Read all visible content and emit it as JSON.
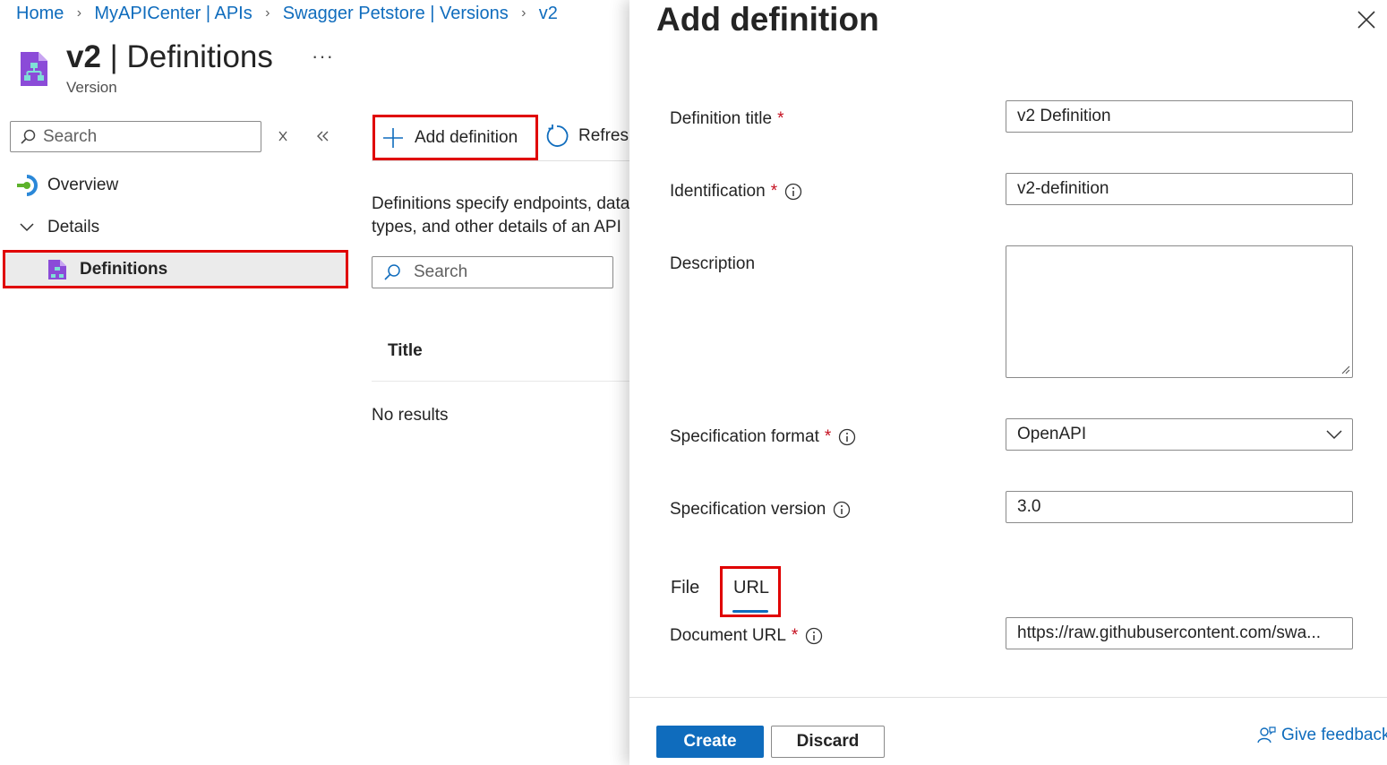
{
  "breadcrumb": [
    "Home",
    "MyAPICenter | APIs",
    "Swagger Petstore | Versions",
    "v2"
  ],
  "page": {
    "title_bold": "v2",
    "title_rest": " | Definitions",
    "subtitle": "Version",
    "more": "···"
  },
  "sidebar": {
    "search_placeholder": "Search",
    "items": [
      {
        "label": "Overview",
        "icon": "overview-icon"
      },
      {
        "label": "Details",
        "icon": "chevron-down-icon"
      },
      {
        "label": "Definitions",
        "icon": "definitions-icon",
        "selected": true
      }
    ]
  },
  "toolbar": {
    "add_label": "Add definition",
    "refresh_label": "Refresh"
  },
  "content": {
    "description": "Definitions specify endpoints, data types, and other details of an API in specification formats, such as OpenAPI, WSDL, GraphQL, and gRPC.",
    "search_placeholder": "Search",
    "column_title": "Title",
    "empty_text": "No results"
  },
  "panel": {
    "title": "Add definition",
    "fields": {
      "definition_title": {
        "label": "Definition title",
        "value": "v2 Definition",
        "required": "*"
      },
      "identification": {
        "label": "Identification",
        "value": "v2-definition",
        "required": "*"
      },
      "description": {
        "label": "Description",
        "value": ""
      },
      "spec_format": {
        "label": "Specification format",
        "value": "OpenAPI",
        "required": "*"
      },
      "spec_version": {
        "label": "Specification version",
        "value": "3.0"
      },
      "document_url": {
        "label": "Document URL",
        "value": "https://raw.githubusercontent.com/swa...",
        "required": "*"
      }
    },
    "tabs": {
      "file": "File",
      "url": "URL",
      "selected": "URL"
    },
    "create_label": "Create",
    "discard_label": "Discard",
    "feedback_label": "Give feedback"
  },
  "colors": {
    "accent": "#0f6cbd",
    "highlight_border": "#e00000",
    "required": "#c50f1f",
    "selected_nav_bg": "#ebebeb"
  }
}
